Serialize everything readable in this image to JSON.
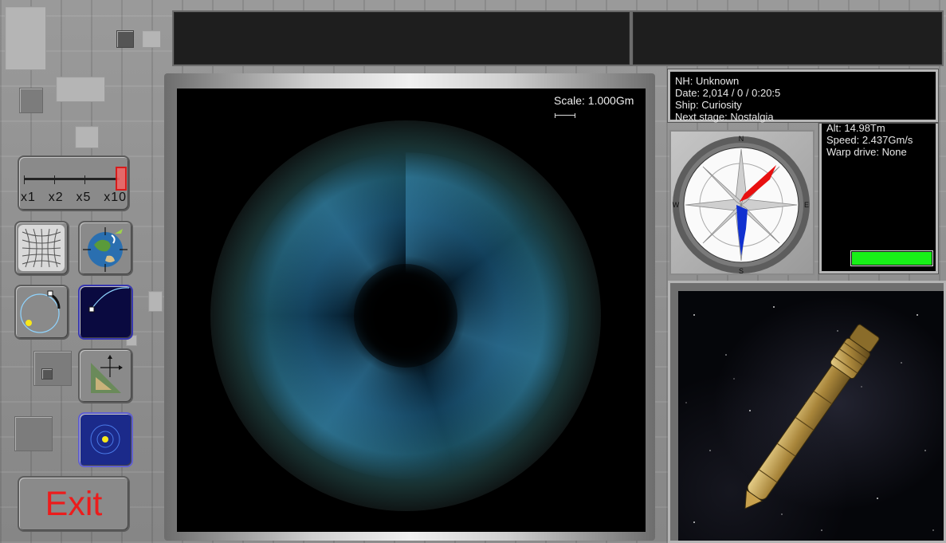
{
  "main_view": {
    "scale_label": "Scale: 1.000Gm"
  },
  "status_panel": {
    "nh": "NH: Unknown",
    "date": "Date: 2,014 / 0 / 0:20:5",
    "ship": "Ship: Curiosity",
    "next_stage": "Next stage: Nostalgia"
  },
  "telemetry_panel": {
    "alt": "Alt: 14.98Tm",
    "speed": "Speed: 2.437Gm/s",
    "warp_drive": "Warp drive: None",
    "warp_bar_level": 1.0,
    "warp_bar_color": "#18f018"
  },
  "compass": {
    "north": "N",
    "east": "E",
    "south": "S",
    "west": "W",
    "needle_colors": {
      "forward": "#e81010",
      "back": "#1030d0"
    }
  },
  "time_warp": {
    "options": [
      "x1",
      "x2",
      "x5",
      "x10"
    ],
    "selected": "x10"
  },
  "tools": {
    "icons": [
      "grid-distortion-icon",
      "planet-target-icon",
      "orbit-icon",
      "orbit-zoom-icon",
      "map-pan-icon",
      "star-system-icon"
    ]
  },
  "exit": {
    "label": "Exit",
    "color": "#ec1c1c"
  }
}
